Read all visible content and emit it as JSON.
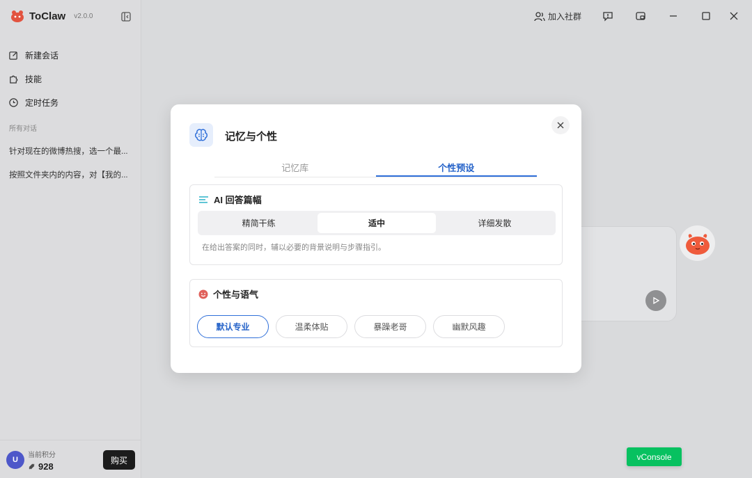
{
  "app": {
    "name": "ToClaw",
    "version": "v2.0.0"
  },
  "sidebar": {
    "nav": [
      {
        "label": "新建会话",
        "icon": "edit-icon"
      },
      {
        "label": "技能",
        "icon": "puzzle-icon"
      },
      {
        "label": "定时任务",
        "icon": "clock-icon"
      }
    ],
    "section_label": "所有对话",
    "conversations": [
      "针对现在的微博热搜，选一个最...",
      "按照文件夹内的内容，对【我的..."
    ],
    "footer": {
      "avatar_letter": "U",
      "points_label": "当前积分",
      "points_value": "928",
      "buy_label": "购买"
    }
  },
  "topbar": {
    "join_label": "加入社群"
  },
  "modal": {
    "title": "记忆与个性",
    "tabs": [
      {
        "label": "记忆库",
        "active": false
      },
      {
        "label": "个性预设",
        "active": true
      }
    ],
    "length_section": {
      "title": "AI 回答篇幅",
      "options": [
        "精简干练",
        "适中",
        "详细发散"
      ],
      "selected": "适中",
      "description": "在给出答案的同时，辅以必要的背景说明与步骤指引。"
    },
    "tone_section": {
      "title": "个性与语气",
      "options": [
        "默认专业",
        "温柔体贴",
        "暴躁老哥",
        "幽默风趣"
      ],
      "selected": "默认专业"
    }
  },
  "vconsole_label": "vConsole",
  "colors": {
    "accent": "#2f6fd9",
    "vconsole": "#07c160",
    "buy_button": "#1c1c1c",
    "avatar": "#4d57c9"
  }
}
